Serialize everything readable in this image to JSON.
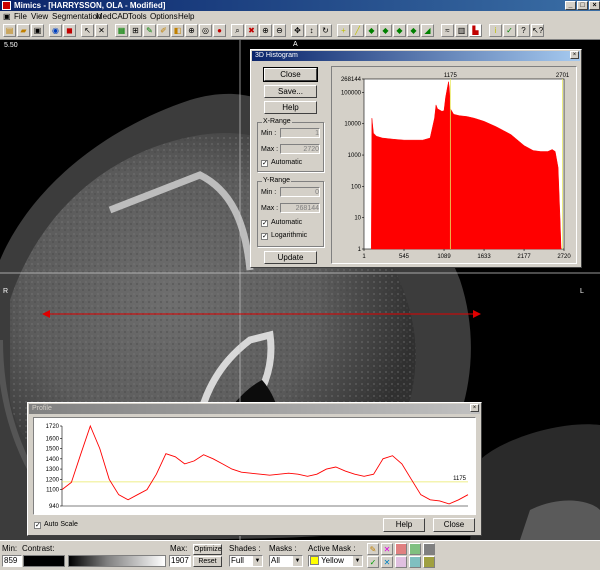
{
  "window": {
    "title": "Mimics - [HARRYSSON, OLA - Modified]"
  },
  "menu": [
    "File",
    "View",
    "Segmentation",
    "MedCAD",
    "Tools",
    "Options",
    "Help"
  ],
  "viewport": {
    "scale_label": "5.50",
    "orient_top": "A",
    "orient_left": "R",
    "orient_right": "L"
  },
  "histogram": {
    "title": "3D Histogram",
    "close_label": "Close",
    "save_label": "Save...",
    "help_label": "Help",
    "xrange_label": "X-Range",
    "xmin_label": "Min :",
    "xmin_value": "1",
    "xmax_label": "Max :",
    "xmax_value": "2720",
    "x_automatic_label": "Automatic",
    "yrange_label": "Y-Range",
    "ymin_label": "Min :",
    "ymin_value": "0",
    "ymax_label": "Max :",
    "ymax_value": "268144",
    "y_automatic_label": "Automatic",
    "y_log_label": "Logarithmic",
    "update_label": "Update",
    "marker_left": "1175",
    "marker_right": "2701"
  },
  "profile": {
    "title": "Profile",
    "autoscale_label": "Auto Scale",
    "help_label": "Help",
    "close_label": "Close",
    "threshold_label": "1175"
  },
  "status": {
    "min_label": "Min:",
    "min_value": "859",
    "contrast_label": "Contrast:",
    "max_label": "Max:",
    "max_value": "1907",
    "optimize_label": "Optimize",
    "reset_label": "Reset",
    "shades_label": "Shades :",
    "shades_value": "Full",
    "masks_label": "Masks :",
    "masks_value": "All",
    "active_mask_label": "Active Mask :",
    "active_mask_value": "Yellow"
  },
  "chart_data": [
    {
      "type": "area",
      "title": "3D Histogram",
      "yscale": "log",
      "xlim": [
        1,
        2720
      ],
      "ylim": [
        1,
        268144
      ],
      "x_ticks": [
        1,
        545,
        1089,
        1633,
        2177,
        2720
      ],
      "y_ticks": [
        1,
        10,
        100,
        1000,
        10000,
        100000,
        268144
      ],
      "color": "#ff0000",
      "markers": [
        1175,
        2701
      ],
      "x": [
        100,
        108,
        130,
        170,
        250,
        400,
        545,
        700,
        800,
        900,
        960,
        980,
        1000,
        1060,
        1089,
        1110,
        1150,
        1160,
        1175,
        1220,
        1300,
        1400,
        1500,
        1633,
        1800,
        1900,
        2000,
        2177,
        2300,
        2400,
        2500,
        2560,
        2600,
        2640,
        2665,
        2680
      ],
      "y": [
        1,
        15000,
        5000,
        4000,
        3500,
        3200,
        3000,
        3000,
        3000,
        3500,
        15000,
        40000,
        30000,
        25000,
        26000,
        70000,
        220000,
        140000,
        30000,
        20000,
        18000,
        17000,
        15000,
        12000,
        8000,
        6000,
        4500,
        2000,
        1400,
        1300,
        1300,
        1500,
        1300,
        400,
        10,
        1
      ]
    },
    {
      "type": "line",
      "title": "Profile",
      "ylim": [
        940,
        1720
      ],
      "y_ticks": [
        940,
        1100,
        1200,
        1300,
        1400,
        1500,
        1600,
        1720
      ],
      "threshold": 1175,
      "series_color": "#ff0000",
      "y": [
        1100,
        1170,
        1450,
        1720,
        1500,
        1200,
        1050,
        1000,
        1050,
        1100,
        1250,
        1450,
        1420,
        1350,
        1380,
        1440,
        1400,
        1350,
        1300,
        1270,
        1260,
        1250,
        1240,
        1250,
        1260,
        1250,
        1230,
        1250,
        1300,
        1320,
        1280,
        1250,
        1230,
        1250,
        1400,
        1430,
        1350,
        1200,
        1050,
        1000,
        990,
        960,
        1000,
        1050
      ]
    }
  ]
}
